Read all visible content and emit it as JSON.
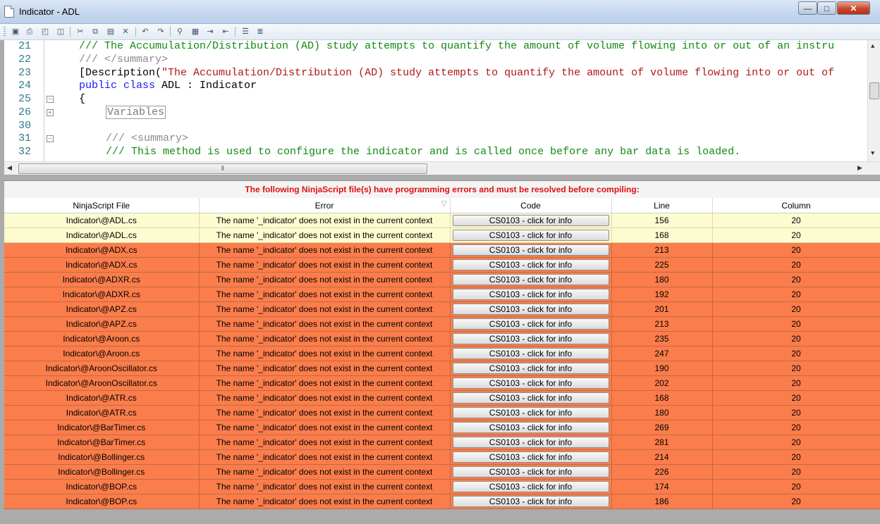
{
  "window": {
    "title": "Indicator - ADL",
    "minimize_glyph": "—",
    "maximize_glyph": "□",
    "close_glyph": "✕"
  },
  "toolbar": {
    "icons": [
      "save-icon",
      "print-icon",
      "print-preview-icon",
      "page-setup-icon",
      "cut-icon",
      "copy-icon",
      "paste-icon",
      "delete-icon",
      "undo-icon",
      "redo-icon",
      "find-icon",
      "find-replace-icon",
      "indent-icon",
      "outdent-icon",
      "comment-icon",
      "uncomment-icon"
    ]
  },
  "editor": {
    "lines": [
      {
        "num": "21",
        "fold": "",
        "parts": [
          {
            "cls": "c-green",
            "text": "/// The Accumulation/Distribution (AD) study attempts to quantify the amount of volume flowing into or out of an instru"
          }
        ]
      },
      {
        "num": "22",
        "fold": "",
        "parts": [
          {
            "cls": "c-gray",
            "text": "/// </summary>"
          }
        ]
      },
      {
        "num": "23",
        "fold": "",
        "parts": [
          {
            "cls": "c-black",
            "text": "[Description("
          },
          {
            "cls": "c-red",
            "text": "\"The Accumulation/Distribution (AD) study attempts to quantify the amount of volume flowing into or out of"
          }
        ]
      },
      {
        "num": "24",
        "fold": "",
        "parts": [
          {
            "cls": "c-blue",
            "text": "public class "
          },
          {
            "cls": "c-black",
            "text": "ADL : Indicator"
          }
        ]
      },
      {
        "num": "25",
        "fold": "−",
        "parts": [
          {
            "cls": "c-black",
            "text": "{"
          }
        ]
      },
      {
        "num": "26",
        "fold": "+",
        "parts": [
          {
            "cls": "region",
            "text": "Variables"
          }
        ]
      },
      {
        "num": "30",
        "fold": "",
        "parts": [
          {
            "cls": "c-black",
            "text": ""
          }
        ]
      },
      {
        "num": "31",
        "fold": "−",
        "parts": [
          {
            "cls": "c-gray",
            "text": "/// <summary>"
          }
        ]
      },
      {
        "num": "32",
        "fold": "",
        "parts": [
          {
            "cls": "c-green",
            "text": "/// This method is used to configure the indicator and is called once before any bar data is loaded."
          }
        ]
      }
    ]
  },
  "errors": {
    "header": "The following NinjaScript file(s) have programming errors and must be resolved before compiling:",
    "columns": [
      "NinjaScript File",
      "Error",
      "Code",
      "Line",
      "Column"
    ],
    "rows": [
      {
        "file": "Indicator\\@ADL.cs",
        "error": "The name '_indicator' does not exist in the current context",
        "code": "CS0103 - click for info",
        "line": "156",
        "column": "20",
        "kind": "warn"
      },
      {
        "file": "Indicator\\@ADL.cs",
        "error": "The name '_indicator' does not exist in the current context",
        "code": "CS0103 - click for info",
        "line": "168",
        "column": "20",
        "kind": "warn"
      },
      {
        "file": "Indicator\\@ADX.cs",
        "error": "The name '_indicator' does not exist in the current context",
        "code": "CS0103 - click for info",
        "line": "213",
        "column": "20",
        "kind": "error"
      },
      {
        "file": "Indicator\\@ADX.cs",
        "error": "The name '_indicator' does not exist in the current context",
        "code": "CS0103 - click for info",
        "line": "225",
        "column": "20",
        "kind": "error"
      },
      {
        "file": "Indicator\\@ADXR.cs",
        "error": "The name '_indicator' does not exist in the current context",
        "code": "CS0103 - click for info",
        "line": "180",
        "column": "20",
        "kind": "error"
      },
      {
        "file": "Indicator\\@ADXR.cs",
        "error": "The name '_indicator' does not exist in the current context",
        "code": "CS0103 - click for info",
        "line": "192",
        "column": "20",
        "kind": "error"
      },
      {
        "file": "Indicator\\@APZ.cs",
        "error": "The name '_indicator' does not exist in the current context",
        "code": "CS0103 - click for info",
        "line": "201",
        "column": "20",
        "kind": "error"
      },
      {
        "file": "Indicator\\@APZ.cs",
        "error": "The name '_indicator' does not exist in the current context",
        "code": "CS0103 - click for info",
        "line": "213",
        "column": "20",
        "kind": "error"
      },
      {
        "file": "Indicator\\@Aroon.cs",
        "error": "The name '_indicator' does not exist in the current context",
        "code": "CS0103 - click for info",
        "line": "235",
        "column": "20",
        "kind": "error"
      },
      {
        "file": "Indicator\\@Aroon.cs",
        "error": "The name '_indicator' does not exist in the current context",
        "code": "CS0103 - click for info",
        "line": "247",
        "column": "20",
        "kind": "error"
      },
      {
        "file": "Indicator\\@AroonOscillator.cs",
        "error": "The name '_indicator' does not exist in the current context",
        "code": "CS0103 - click for info",
        "line": "190",
        "column": "20",
        "kind": "error"
      },
      {
        "file": "Indicator\\@AroonOscillator.cs",
        "error": "The name '_indicator' does not exist in the current context",
        "code": "CS0103 - click for info",
        "line": "202",
        "column": "20",
        "kind": "error"
      },
      {
        "file": "Indicator\\@ATR.cs",
        "error": "The name '_indicator' does not exist in the current context",
        "code": "CS0103 - click for info",
        "line": "168",
        "column": "20",
        "kind": "error"
      },
      {
        "file": "Indicator\\@ATR.cs",
        "error": "The name '_indicator' does not exist in the current context",
        "code": "CS0103 - click for info",
        "line": "180",
        "column": "20",
        "kind": "error"
      },
      {
        "file": "Indicator\\@BarTimer.cs",
        "error": "The name '_indicator' does not exist in the current context",
        "code": "CS0103 - click for info",
        "line": "269",
        "column": "20",
        "kind": "error"
      },
      {
        "file": "Indicator\\@BarTimer.cs",
        "error": "The name '_indicator' does not exist in the current context",
        "code": "CS0103 - click for info",
        "line": "281",
        "column": "20",
        "kind": "error"
      },
      {
        "file": "Indicator\\@Bollinger.cs",
        "error": "The name '_indicator' does not exist in the current context",
        "code": "CS0103 - click for info",
        "line": "214",
        "column": "20",
        "kind": "error"
      },
      {
        "file": "Indicator\\@Bollinger.cs",
        "error": "The name '_indicator' does not exist in the current context",
        "code": "CS0103 - click for info",
        "line": "226",
        "column": "20",
        "kind": "error"
      },
      {
        "file": "Indicator\\@BOP.cs",
        "error": "The name '_indicator' does not exist in the current context",
        "code": "CS0103 - click for info",
        "line": "174",
        "column": "20",
        "kind": "error"
      },
      {
        "file": "Indicator\\@BOP.cs",
        "error": "The name '_indicator' does not exist in the current context",
        "code": "CS0103 - click for info",
        "line": "186",
        "column": "20",
        "kind": "error"
      }
    ]
  },
  "colors": {
    "error_row": "#fa7d4b",
    "warn_row": "#fdfbd0",
    "header_text": "#e01010"
  }
}
